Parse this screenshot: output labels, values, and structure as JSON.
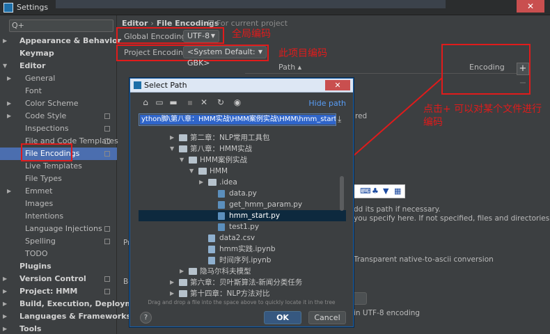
{
  "window": {
    "title": "Settings",
    "close": "✕"
  },
  "search": {
    "icon": "Q+",
    "placeholder": ""
  },
  "sidebar": {
    "items": [
      {
        "label": "Appearance & Behavior",
        "bold": true,
        "arrow": "▶"
      },
      {
        "label": "Keymap",
        "bold": true,
        "arrow": ""
      },
      {
        "label": "Editor",
        "bold": true,
        "arrow": "▼"
      },
      {
        "label": "General",
        "arrow": "▶"
      },
      {
        "label": "Font",
        "arrow": ""
      },
      {
        "label": "Color Scheme",
        "arrow": "▶"
      },
      {
        "label": "Code Style",
        "arrow": "▶",
        "project_icon": true
      },
      {
        "label": "Inspections",
        "arrow": "",
        "project_icon": true
      },
      {
        "label": "File and Code Templates",
        "arrow": "",
        "project_icon": true
      },
      {
        "label": "File Encodings",
        "arrow": "",
        "project_icon": true,
        "selected": true
      },
      {
        "label": "Live Templates",
        "arrow": ""
      },
      {
        "label": "File Types",
        "arrow": ""
      },
      {
        "label": "Emmet",
        "arrow": "▶"
      },
      {
        "label": "Images",
        "arrow": ""
      },
      {
        "label": "Intentions",
        "arrow": ""
      },
      {
        "label": "Language Injections",
        "arrow": "",
        "project_icon": true
      },
      {
        "label": "Spelling",
        "arrow": "",
        "project_icon": true
      },
      {
        "label": "TODO",
        "arrow": ""
      },
      {
        "label": "Plugins",
        "bold": true,
        "arrow": ""
      },
      {
        "label": "Version Control",
        "bold": true,
        "arrow": "▶",
        "project_icon": true
      },
      {
        "label": "Project: HMM",
        "bold": true,
        "arrow": "▶",
        "project_icon": true
      },
      {
        "label": "Build, Execution, Deployment",
        "bold": true,
        "arrow": "▶"
      },
      {
        "label": "Languages & Frameworks",
        "bold": true,
        "arrow": "▶"
      },
      {
        "label": "Tools",
        "bold": true,
        "arrow": "▶"
      }
    ]
  },
  "breadcrumb": {
    "root": "Editor",
    "sep": "›",
    "current": "File Encodings",
    "scope": "For current project"
  },
  "global_encoding": {
    "label": "Global Encoding:",
    "value": "UTF-8"
  },
  "project_encoding": {
    "label": "Project Encoding:",
    "value": "<System Default: GBK>"
  },
  "annotations": {
    "global": "全局编码",
    "project": "此项目编码",
    "encoding_tip": "点击+ 可以对某个文件进行编码"
  },
  "table": {
    "path_header": "Path ▴",
    "encoding_header": "Encoding",
    "add": "+",
    "remove": "−"
  },
  "background_fragments": {
    "red": "red",
    "add_path_1": "dd its path if necessary.",
    "add_path_2": "you specify here. If not specified, files and directories",
    "native_ascii": "Transparent native-to-ascii conversion",
    "utf8_tail": "in UTF-8 encoding",
    "pr": "Pr",
    "bo": "Bo"
  },
  "ime": {
    "logo": "S",
    "lang": "中",
    "punct": "°,",
    "emoji": "☺",
    "mic": "♪",
    "kb": "⌨",
    "skin": "♣",
    "shirt": "▼",
    "grid": "▦"
  },
  "dialog": {
    "title": "Select Path",
    "close": "✕",
    "hide_path": "Hide path",
    "path_value": "ython脚\\第八章：HMM实战\\HMM案例实战\\HMM\\hmm_start.py",
    "download_icon": "⤓",
    "tree": [
      {
        "name": "第二章：NLP常用工具包",
        "arrow": "▶",
        "kind": "folder",
        "depth": 4
      },
      {
        "name": "第八章：HMM实战",
        "arrow": "▼",
        "kind": "folder",
        "depth": 4
      },
      {
        "name": "HMM案例实战",
        "arrow": "▼",
        "kind": "folder",
        "depth": 5
      },
      {
        "name": "HMM",
        "arrow": "▼",
        "kind": "folder",
        "depth": 6
      },
      {
        "name": ".idea",
        "arrow": "▶",
        "kind": "folder",
        "depth": 7
      },
      {
        "name": "data.py",
        "arrow": "",
        "kind": "file",
        "depth": 8
      },
      {
        "name": "get_hmm_param.py",
        "arrow": "",
        "kind": "file",
        "depth": 8
      },
      {
        "name": "hmm_start.py",
        "arrow": "",
        "kind": "file",
        "depth": 8,
        "selected": true
      },
      {
        "name": "test1.py",
        "arrow": "",
        "kind": "file",
        "depth": 8
      },
      {
        "name": "data2.csv",
        "arrow": "",
        "kind": "nb",
        "depth": 7
      },
      {
        "name": "hmm实践.ipynb",
        "arrow": "",
        "kind": "nb",
        "depth": 7
      },
      {
        "name": "时间序列.ipynb",
        "arrow": "",
        "kind": "nb",
        "depth": 7
      },
      {
        "name": "隐马尔科夫模型",
        "arrow": "▶",
        "kind": "folder",
        "depth": 5
      },
      {
        "name": "第六章：贝叶斯算法-新闻分类任务",
        "arrow": "▶",
        "kind": "folder",
        "depth": 4
      },
      {
        "name": "第十四章：NLP方法对比",
        "arrow": "▶",
        "kind": "folder",
        "depth": 4
      }
    ],
    "hint": "Drag and drop a file into the space above to quickly locate it in the tree",
    "help": "?",
    "ok": "OK",
    "cancel": "Cancel"
  },
  "colors": {
    "annotation_red": "#e01b1b",
    "selection_blue": "#4b6eaf",
    "link_blue": "#589df6",
    "ok_button": "#365880"
  }
}
